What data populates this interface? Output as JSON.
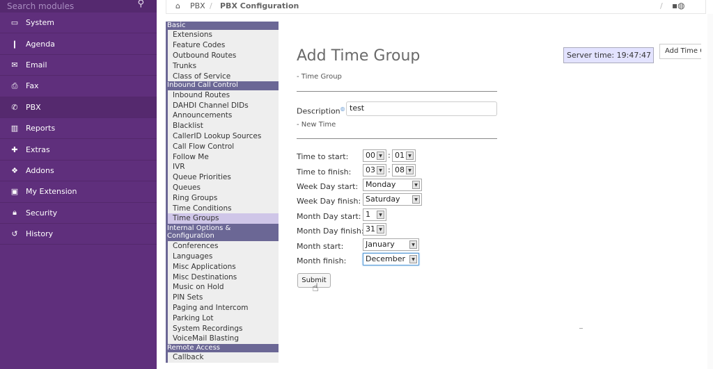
{
  "search": {
    "placeholder": "Search modules"
  },
  "leftnav": {
    "items": [
      {
        "icon": "laptop-icon",
        "glyph": "▭",
        "label": "System"
      },
      {
        "icon": "book-icon",
        "glyph": "❙",
        "label": "Agenda"
      },
      {
        "icon": "envelope-icon",
        "glyph": "✉",
        "label": "Email"
      },
      {
        "icon": "printer-icon",
        "glyph": "⎙",
        "label": "Fax"
      },
      {
        "icon": "phone-icon",
        "glyph": "✆",
        "label": "PBX"
      },
      {
        "icon": "bar-chart-icon",
        "glyph": "▥",
        "label": "Reports"
      },
      {
        "icon": "plus-icon",
        "glyph": "✚",
        "label": "Extras"
      },
      {
        "icon": "cubes-icon",
        "glyph": "❖",
        "label": "Addons"
      },
      {
        "icon": "id-card-icon",
        "glyph": "▣",
        "label": "My Extension"
      },
      {
        "icon": "lock-icon",
        "glyph": "🔒︎",
        "label": "Security"
      },
      {
        "icon": "history-icon",
        "glyph": "↺",
        "label": "History"
      }
    ]
  },
  "breadcrumb": {
    "c1": "PBX",
    "sep": "/",
    "c2": "PBX Configuration",
    "sep2": "/",
    "tools": "▪◍"
  },
  "submenu": {
    "cat_basic": "Basic",
    "basic": [
      "Extensions",
      "Feature Codes",
      "Outbound Routes",
      "Trunks",
      "Class of Service"
    ],
    "cat_inbound": "Inbound Call Control",
    "inbound": [
      "Inbound Routes",
      "DAHDI Channel DIDs",
      "Announcements",
      "Blacklist",
      "CallerID Lookup Sources",
      "Call Flow Control",
      "Follow Me",
      "IVR",
      "Queue Priorities",
      "Queues",
      "Ring Groups",
      "Time Conditions",
      "Time Groups"
    ],
    "cat_internal": "Internal Options & Configuration",
    "internal": [
      "Conferences",
      "Languages",
      "Misc Applications",
      "Misc Destinations",
      "Music on Hold",
      "PIN Sets",
      "Paging and Intercom",
      "Parking Lot",
      "System Recordings",
      "VoiceMail Blasting"
    ],
    "cat_remote": "Remote Access",
    "remote": [
      "Callback"
    ]
  },
  "main": {
    "title": "Add Time Group",
    "section_time_group": "- Time Group",
    "description_label": "Description",
    "description_value": "test",
    "section_new_time": "- New Time",
    "time_start_label": "Time to start:",
    "time_start_h": "00",
    "time_start_m": "01",
    "time_finish_label": "Time to finish:",
    "time_finish_h": "03",
    "time_finish_m": "08",
    "wday_start_label": "Week Day start:",
    "wday_start": "Monday",
    "wday_finish_label": "Week Day finish:",
    "wday_finish": "Saturday",
    "mday_start_label": "Month Day start:",
    "mday_start": "1",
    "mday_finish_label": "Month Day finish:",
    "mday_finish": "31",
    "month_start_label": "Month start:",
    "month_start": "January",
    "month_finish_label": "Month finish:",
    "month_finish": "December",
    "submit": "Submit",
    "colon": ":"
  },
  "server_time": "Server time: 19:47:47",
  "add_time_tab": "Add Time Group"
}
